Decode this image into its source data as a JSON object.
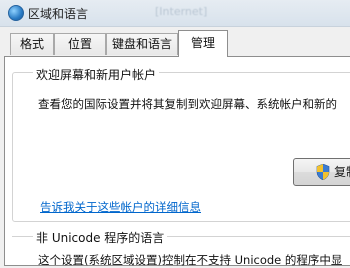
{
  "window": {
    "title": "区域和语言",
    "ghost_title": "[Internet]"
  },
  "tabs": [
    {
      "label": "格式",
      "active": false
    },
    {
      "label": "位置",
      "active": false
    },
    {
      "label": "键盘和语言",
      "active": false
    },
    {
      "label": "管理",
      "active": true
    }
  ],
  "welcome_group": {
    "title": "欢迎屏幕和新用户帐户",
    "description": "查看您的国际设置并将其复制到欢迎屏幕、系统帐户和新的",
    "copy_button_label": "复制",
    "link_text": "告诉我关于这些帐户的详细信息"
  },
  "nonunicode_group": {
    "title": "非 Unicode 程序的语言",
    "description": "这个设置(系统区域设置)控制在不支持 Unicode 的程序中显"
  },
  "colors": {
    "link": "#0066cc",
    "shield_blue": "#3b7bd1",
    "shield_yellow": "#f2c12e"
  }
}
